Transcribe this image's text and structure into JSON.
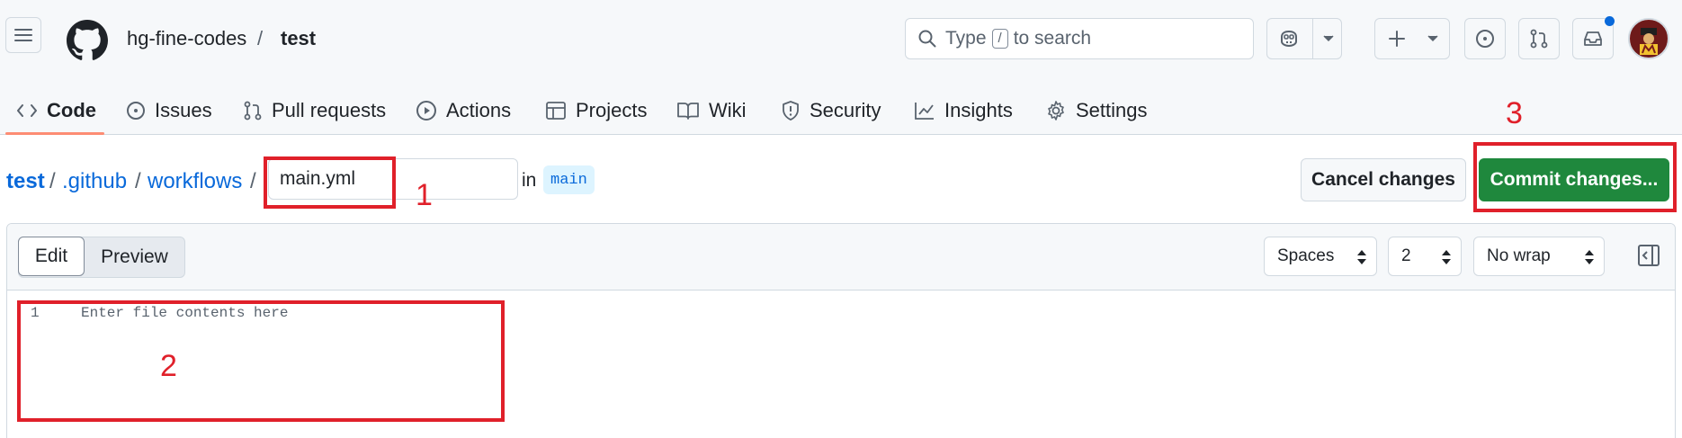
{
  "header": {
    "owner": "hg-fine-codes",
    "separator": "/",
    "repo": "test",
    "search": {
      "prefix": "Type",
      "key": "/",
      "suffix": "to search"
    }
  },
  "nav": {
    "items": [
      {
        "label": "Code",
        "icon": "code-icon",
        "selected": true
      },
      {
        "label": "Issues",
        "icon": "issue-icon"
      },
      {
        "label": "Pull requests",
        "icon": "pull-request-icon"
      },
      {
        "label": "Actions",
        "icon": "play-icon"
      },
      {
        "label": "Projects",
        "icon": "table-icon"
      },
      {
        "label": "Wiki",
        "icon": "book-icon"
      },
      {
        "label": "Security",
        "icon": "shield-icon"
      },
      {
        "label": "Insights",
        "icon": "graph-icon"
      },
      {
        "label": "Settings",
        "icon": "gear-icon"
      }
    ]
  },
  "path": {
    "root": "test",
    "dir1": ".github",
    "dir2": "workflows",
    "sep": "/",
    "filename": "main.yml",
    "in_label": "in",
    "branch": "main"
  },
  "actions": {
    "cancel": "Cancel changes",
    "commit": "Commit changes..."
  },
  "editor": {
    "tab_edit": "Edit",
    "tab_preview": "Preview",
    "indent_mode": "Spaces",
    "indent_size": "2",
    "wrap_mode": "No wrap",
    "line_number": "1",
    "placeholder": "Enter file contents here"
  },
  "annotations": {
    "one": "1",
    "two": "2",
    "three": "3",
    "color": "#e0202a"
  },
  "colors": {
    "accent": "#0969da",
    "commit_green": "#1f883d",
    "nav_underline": "#fd8c73"
  }
}
